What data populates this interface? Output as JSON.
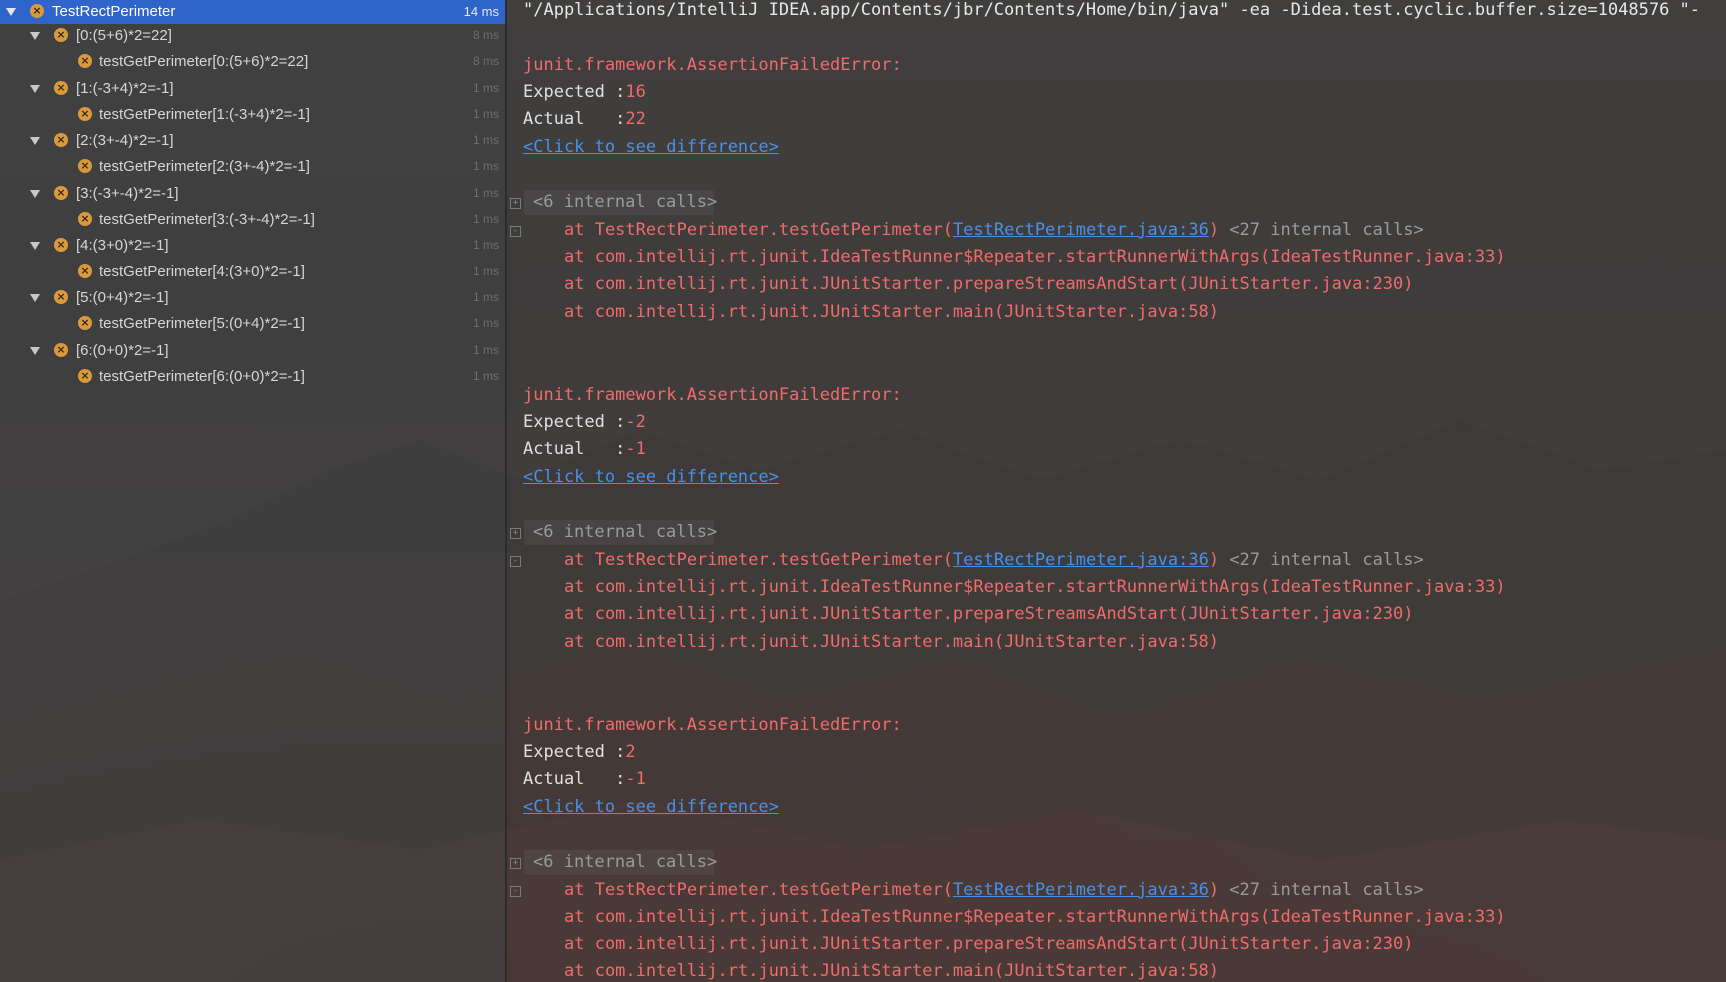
{
  "tree": {
    "root": {
      "label": "TestRectPerimeter",
      "time": "14 ms"
    },
    "groups": [
      {
        "label": "[0:(5+6)*2=22]",
        "time": "8 ms",
        "child": "testGetPerimeter[0:(5+6)*2=22]",
        "child_time": "8 ms"
      },
      {
        "label": "[1:(-3+4)*2=-1]",
        "time": "1 ms",
        "child": "testGetPerimeter[1:(-3+4)*2=-1]",
        "child_time": "1 ms"
      },
      {
        "label": "[2:(3+-4)*2=-1]",
        "time": "1 ms",
        "child": "testGetPerimeter[2:(3+-4)*2=-1]",
        "child_time": "1 ms"
      },
      {
        "label": "[3:(-3+-4)*2=-1]",
        "time": "1 ms",
        "child": "testGetPerimeter[3:(-3+-4)*2=-1]",
        "child_time": "1 ms"
      },
      {
        "label": "[4:(3+0)*2=-1]",
        "time": "1 ms",
        "child": "testGetPerimeter[4:(3+0)*2=-1]",
        "child_time": "1 ms"
      },
      {
        "label": "[5:(0+4)*2=-1]",
        "time": "1 ms",
        "child": "testGetPerimeter[5:(0+4)*2=-1]",
        "child_time": "1 ms"
      },
      {
        "label": "[6:(0+0)*2=-1]",
        "time": "1 ms",
        "child": "testGetPerimeter[6:(0+0)*2=-1]",
        "child_time": "1 ms"
      }
    ]
  },
  "console": {
    "command": "\"/Applications/IntelliJ IDEA.app/Contents/jbr/Contents/Home/bin/java\" -ea -Didea.test.cyclic.buffer.size=1048576 \"-",
    "blocks": [
      {
        "error": "junit.framework.AssertionFailedError:",
        "expected_label": "Expected :",
        "expected": "16",
        "actual_label": "Actual   :",
        "actual": "22",
        "diff_link": "<Click to see difference>",
        "internal_calls": "<6 internal calls>",
        "trace_prefix": "at TestRectPerimeter.testGetPerimeter(",
        "trace_link": "TestRectPerimeter.java:36",
        "trace_suffix": ")",
        "trace_internal": "<27 internal calls>",
        "frames": [
          "at com.intellij.rt.junit.IdeaTestRunner$Repeater.startRunnerWithArgs(IdeaTestRunner.java:33)",
          "at com.intellij.rt.junit.JUnitStarter.prepareStreamsAndStart(JUnitStarter.java:230)",
          "at com.intellij.rt.junit.JUnitStarter.main(JUnitStarter.java:58)"
        ]
      },
      {
        "error": "junit.framework.AssertionFailedError:",
        "expected_label": "Expected :",
        "expected": "-2",
        "actual_label": "Actual   :",
        "actual": "-1",
        "diff_link": "<Click to see difference>",
        "internal_calls": "<6 internal calls>",
        "trace_prefix": "at TestRectPerimeter.testGetPerimeter(",
        "trace_link": "TestRectPerimeter.java:36",
        "trace_suffix": ")",
        "trace_internal": "<27 internal calls>",
        "frames": [
          "at com.intellij.rt.junit.IdeaTestRunner$Repeater.startRunnerWithArgs(IdeaTestRunner.java:33)",
          "at com.intellij.rt.junit.JUnitStarter.prepareStreamsAndStart(JUnitStarter.java:230)",
          "at com.intellij.rt.junit.JUnitStarter.main(JUnitStarter.java:58)"
        ]
      },
      {
        "error": "junit.framework.AssertionFailedError:",
        "expected_label": "Expected :",
        "expected": "2",
        "actual_label": "Actual   :",
        "actual": "-1",
        "diff_link": "<Click to see difference>",
        "internal_calls": "<6 internal calls>",
        "trace_prefix": "at TestRectPerimeter.testGetPerimeter(",
        "trace_link": "TestRectPerimeter.java:36",
        "trace_suffix": ")",
        "trace_internal": "<27 internal calls>",
        "frames": [
          "at com.intellij.rt.junit.IdeaTestRunner$Repeater.startRunnerWithArgs(IdeaTestRunner.java:33)",
          "at com.intellij.rt.junit.JUnitStarter.prepareStreamsAndStart(JUnitStarter.java:230)",
          "at com.intellij.rt.junit.JUnitStarter.main(JUnitStarter.java:58)"
        ]
      }
    ]
  },
  "colors": {
    "selection": "#2f65ca",
    "failure_icon": "#d99a3d",
    "error_text": "#f06b6b",
    "link": "#4a90e8"
  },
  "icons": {
    "tree_toggle": "triangle-down-icon",
    "test_status": "test-failed-icon",
    "fold": "fold-toggle-icon"
  }
}
